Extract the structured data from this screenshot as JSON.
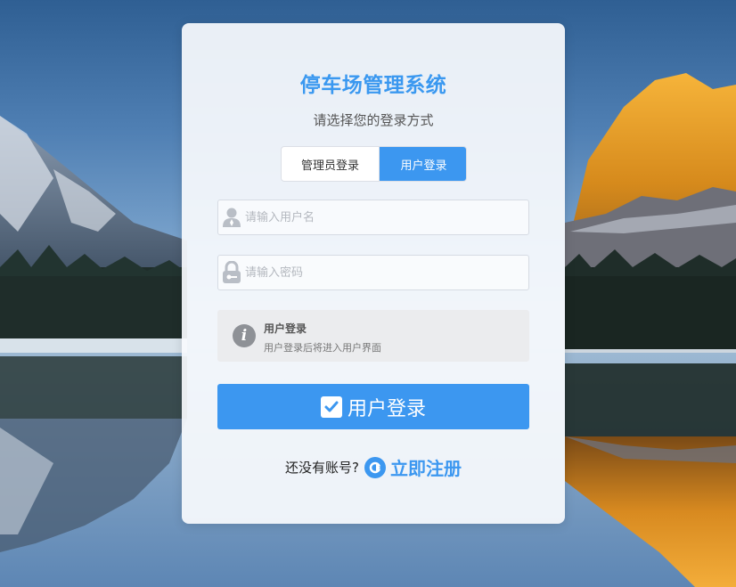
{
  "app": {
    "title": "停车场管理系统",
    "subtitle": "请选择您的登录方式"
  },
  "tabs": [
    {
      "label": "管理员登录",
      "active": false
    },
    {
      "label": "用户登录",
      "active": true
    }
  ],
  "form": {
    "username_placeholder": "请输入用户名",
    "username_value": "",
    "password_placeholder": "请输入密码",
    "password_value": "",
    "username_icon": "user-icon",
    "password_icon": "lock-icon"
  },
  "info": {
    "icon": "info-icon",
    "title": "用户登录",
    "description": "用户登录后将进入用户界面"
  },
  "login_button": {
    "icon": "checkbox-icon",
    "label": "用户登录"
  },
  "register": {
    "question": "还没有账号?",
    "icon": "register-icon",
    "link_label": "立即注册"
  },
  "colors": {
    "accent": "#3c97f0",
    "title": "#3a98f0",
    "card_background": "#f8fafd"
  }
}
